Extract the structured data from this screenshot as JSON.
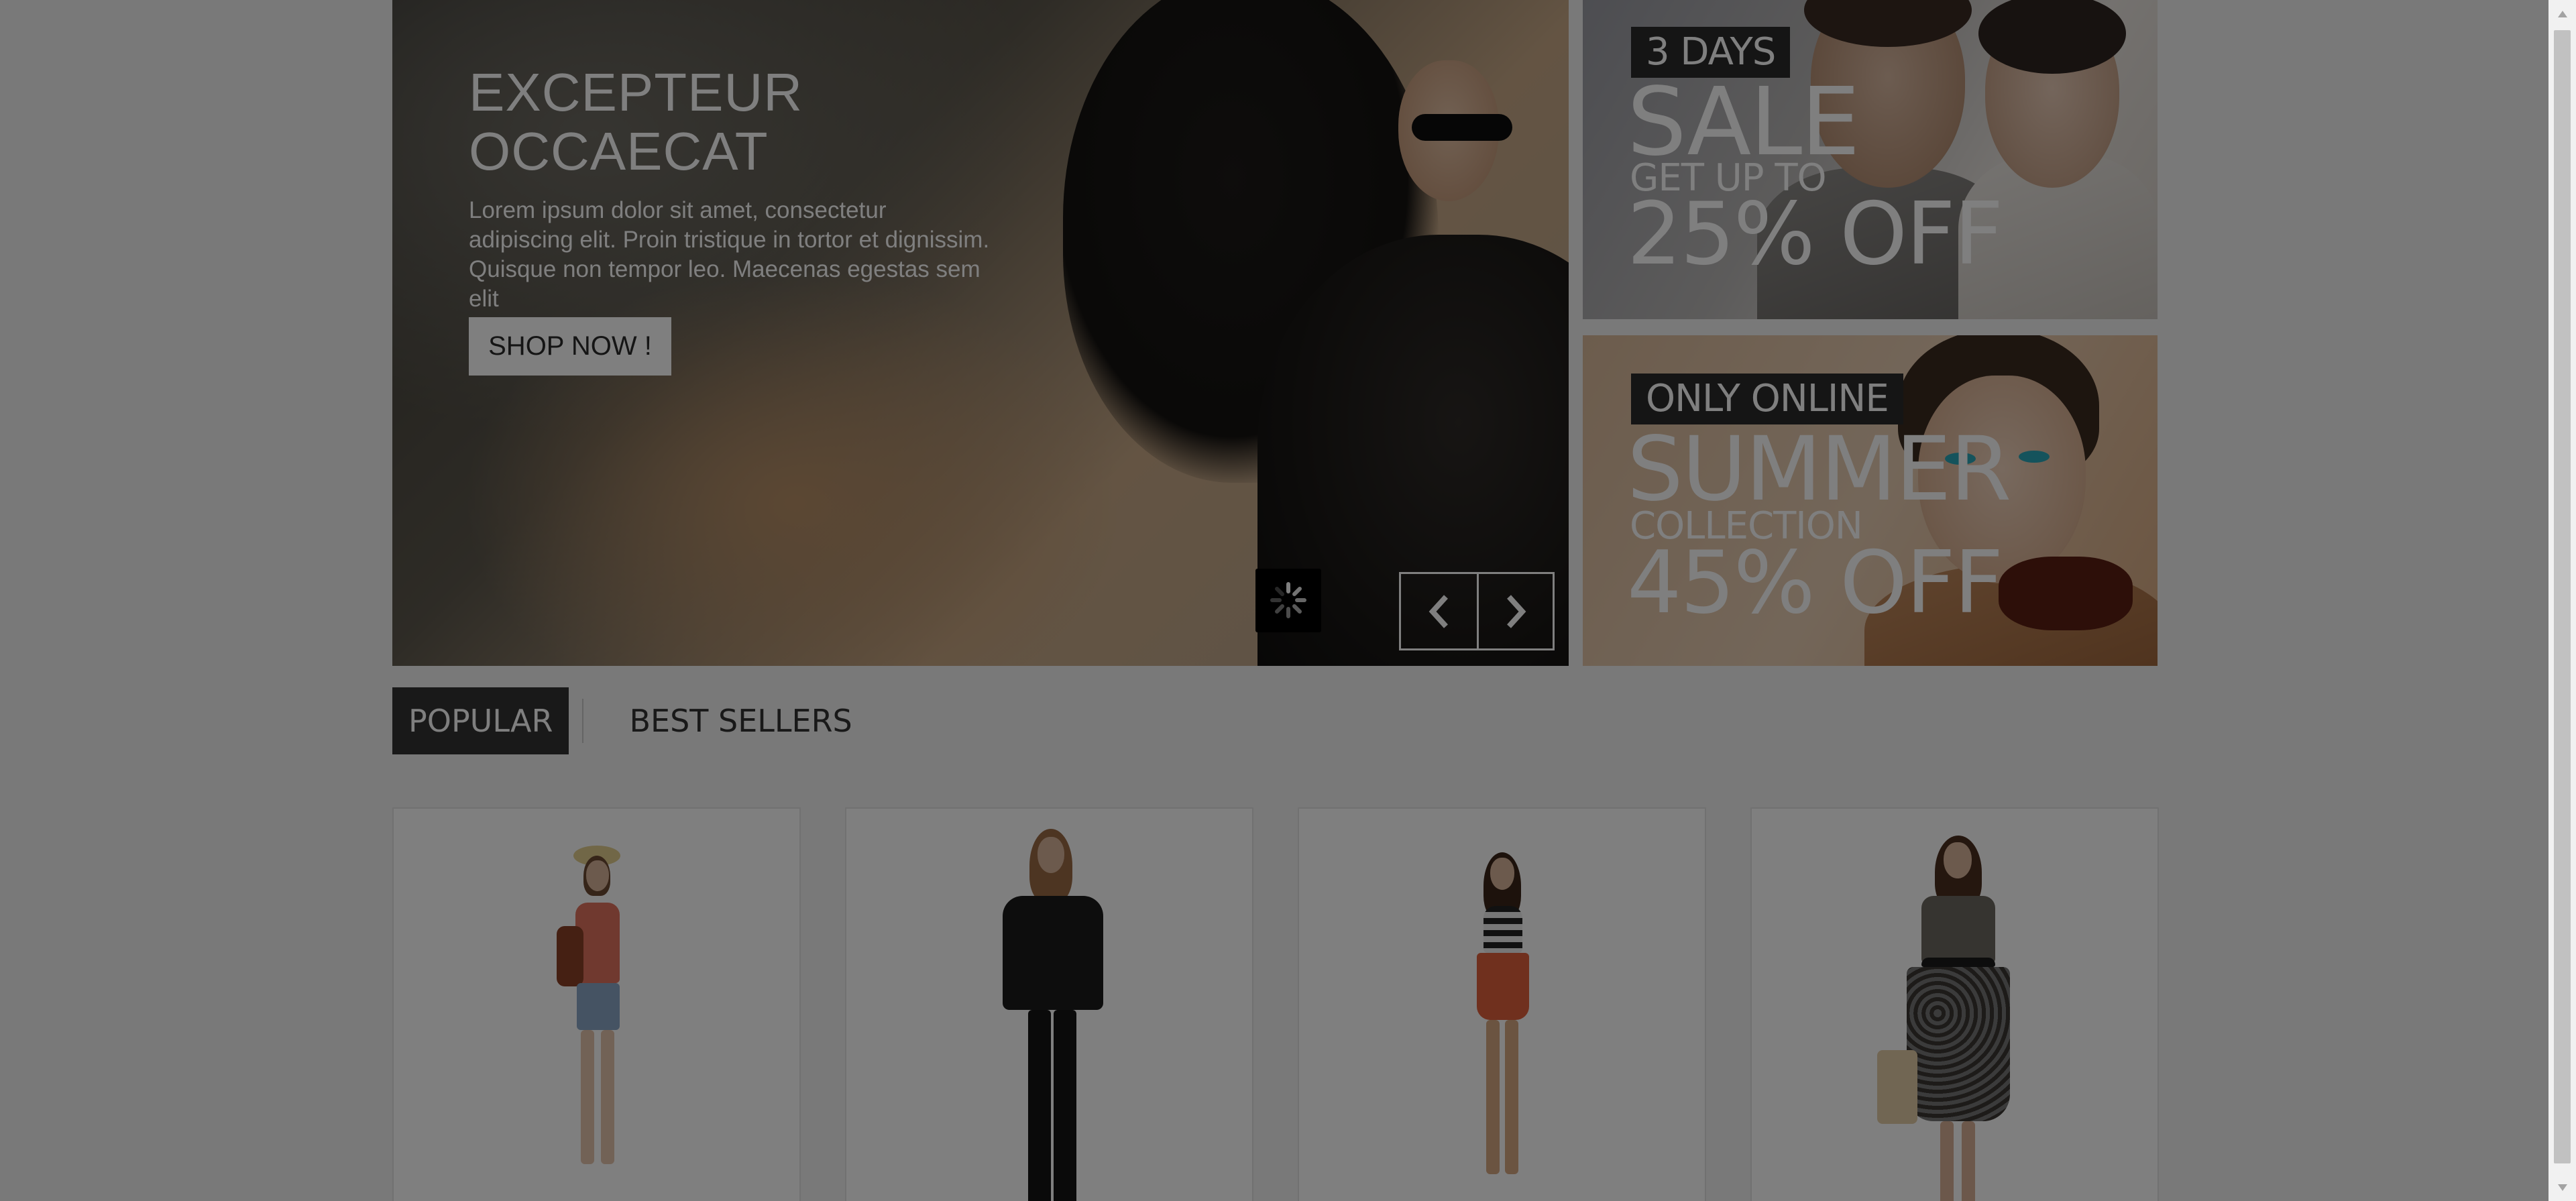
{
  "hero": {
    "title_line1": "EXCEPTEUR",
    "title_line2": "OCCAECAT",
    "description": "Lorem ipsum dolor sit amet, consectetur adipiscing elit. Proin tristique in tortor et dignissim. Quisque non tempor leo. Maecenas egestas sem elit",
    "button_label": "SHOP NOW !",
    "loader_icon": "spinner-icon",
    "prev_icon": "chevron-left-icon",
    "next_icon": "chevron-right-icon"
  },
  "banners": [
    {
      "tag": "3 DAYS",
      "headline": "SALE",
      "subline": "GET UP TO",
      "offer": "25% OFF"
    },
    {
      "tag": "ONLY ONLINE",
      "headline": "SUMMER",
      "subline": "COLLECTION",
      "offer": "45% OFF"
    }
  ],
  "tabs": [
    {
      "label": "POPULAR",
      "active": true
    },
    {
      "label": "BEST SELLERS",
      "active": false
    }
  ],
  "products": [
    {
      "image": "woman in straw hat, coral top and denim shorts"
    },
    {
      "image": "woman in black ruffled top and black jeans"
    },
    {
      "image": "woman in striped top and orange skirt"
    },
    {
      "image": "woman in patterned dress with clutch"
    }
  ],
  "colors": {
    "overlay": "#000000",
    "tab_active_bg": "#333333",
    "tag_bg": "#2b2b2b",
    "button_bg": "#ffffff"
  }
}
